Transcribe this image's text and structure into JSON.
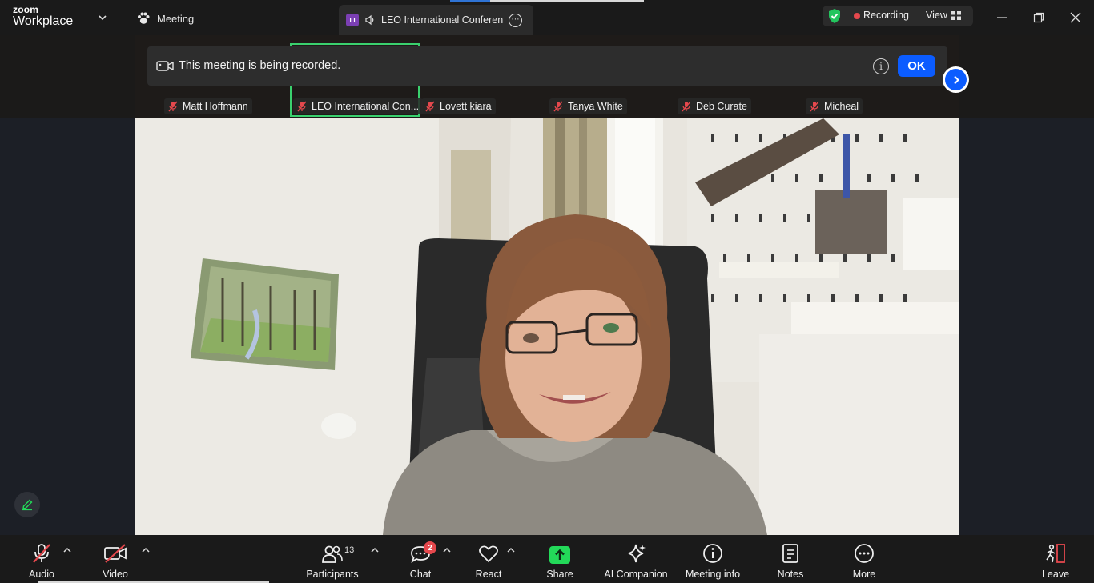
{
  "brand": {
    "small": "zoom",
    "big": "Workplace"
  },
  "menu": {
    "meeting_label": "Meeting"
  },
  "tab": {
    "avatar": "LI",
    "title": "LEO International Conference"
  },
  "status": {
    "recording_label": "Recording",
    "view_label": "View"
  },
  "banner": {
    "text": "This meeting is being recorded.",
    "ok_label": "OK"
  },
  "participants_strip": [
    {
      "name": "Matt Hoffmann",
      "muted": true,
      "active": false
    },
    {
      "name": "LEO International Con...",
      "muted": true,
      "active": true
    },
    {
      "name": "Lovett kiara",
      "muted": true,
      "active": false
    },
    {
      "name": "Tanya White",
      "muted": true,
      "active": false
    },
    {
      "name": "Deb Curate",
      "muted": true,
      "active": false
    },
    {
      "name": "Micheal",
      "muted": true,
      "active": false
    }
  ],
  "toolbar": {
    "audio_label": "Audio",
    "video_label": "Video",
    "participants_label": "Participants",
    "participants_count": "13",
    "chat_label": "Chat",
    "chat_badge": "2",
    "react_label": "React",
    "share_label": "Share",
    "ai_label": "AI Companion",
    "info_label": "Meeting info",
    "notes_label": "Notes",
    "more_label": "More",
    "leave_label": "Leave"
  },
  "colors": {
    "accent_blue": "#0b5cff",
    "share_green": "#23d959",
    "active_speaker_border": "#3ad16e",
    "recording_red": "#e5484d"
  }
}
